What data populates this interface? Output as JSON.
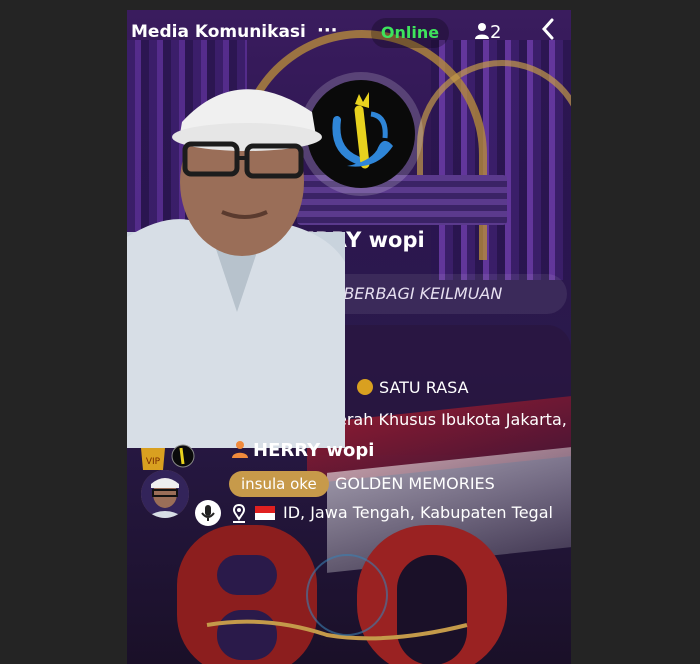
{
  "header": {
    "title": "Media Komunikasi",
    "more_label": "···",
    "status": "Online",
    "viewer_count": "2",
    "back_label": "‹"
  },
  "profile": {
    "host_name": "HERRY wopi",
    "motto": "AN DAN BERBAGI KEILMUAN",
    "tag_line": "SATU   RASA",
    "location_line": "erah Khusus Ibukota Jakarta,"
  },
  "member": {
    "name": "HERRY wopi",
    "level_pill": "insula oke",
    "group": "GOLDEN MEMORIES",
    "location": "ID, Jawa Tengah, Kabupaten Tegal"
  },
  "colors": {
    "online": "#3ee35c",
    "pill": "#c79a4a",
    "background": "#2c1650"
  }
}
